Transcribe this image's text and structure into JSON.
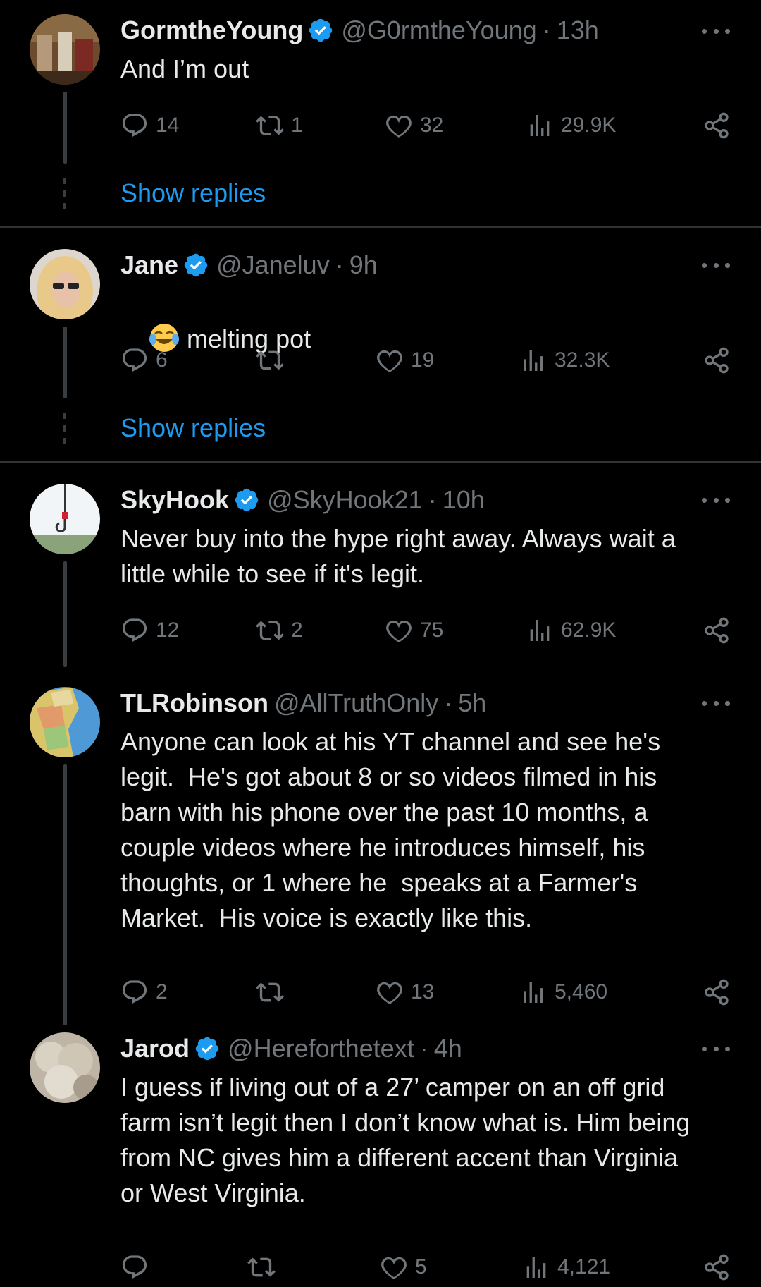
{
  "tweets": [
    {
      "name": "GormtheYoung",
      "verified": true,
      "handle": "@G0rmtheYoung",
      "time": "13h",
      "text": "And I’m out",
      "stats": {
        "replies": "14",
        "retweets": "1",
        "likes": "32",
        "views": "29.9K"
      },
      "show_replies": "Show replies"
    },
    {
      "name": "Jane",
      "verified": true,
      "handle": "@Janeluv",
      "time": "9h",
      "emoji": "face-with-tears-of-joy",
      "text": "melting pot",
      "stats": {
        "replies": "6",
        "retweets": "",
        "likes": "19",
        "views": "32.3K"
      },
      "show_replies": "Show replies"
    },
    {
      "name": "SkyHook",
      "verified": true,
      "handle": "@SkyHook21",
      "time": "10h",
      "text": "Never buy into the hype right away. Always wait a\nlittle while to see if it's legit.",
      "stats": {
        "replies": "12",
        "retweets": "2",
        "likes": "75",
        "views": "62.9K"
      }
    },
    {
      "name": "TLRobinson",
      "verified": false,
      "handle": "@AllTruthOnly",
      "time": "5h",
      "text": "Anyone can look at his YT channel and see he's\nlegit.  He's got about 8 or so videos filmed in his\nbarn with his phone over the past 10 months, a\ncouple videos where he introduces himself, his\nthoughts, or 1 where he  speaks at a Farmer's\nMarket.  His voice is exactly like this.",
      "stats": {
        "replies": "2",
        "retweets": "",
        "likes": "13",
        "views": "5,460"
      }
    },
    {
      "name": "Jarod",
      "verified": true,
      "handle": "@Hereforthetext",
      "time": "4h",
      "text": "I guess if living out of a 27’ camper on an off grid\nfarm isn’t legit then I don’t know what is. Him being\nfrom NC gives him a different accent than Virginia\nor West Virginia.",
      "stats": {
        "replies": "",
        "retweets": "",
        "likes": "5",
        "views": "4,121"
      }
    }
  ],
  "separator": "·"
}
